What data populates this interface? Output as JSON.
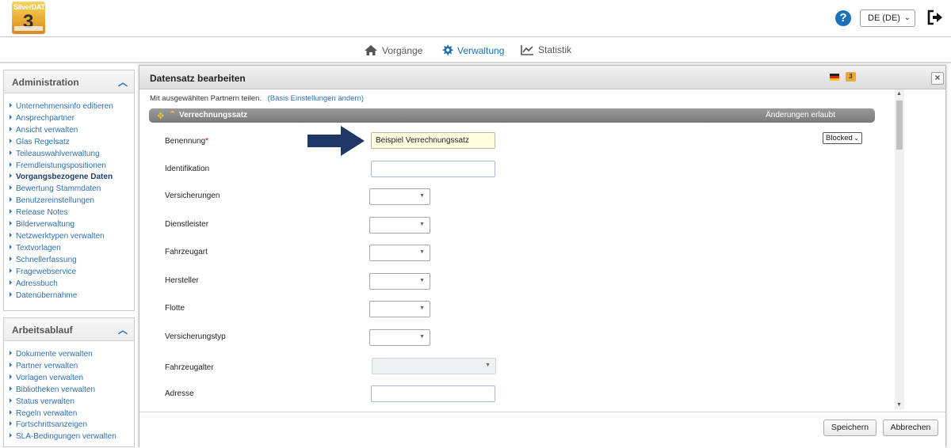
{
  "app": {
    "logo_text": "SilverDAT",
    "logo_number": "3",
    "language": "DE (DE)"
  },
  "nav": {
    "items": [
      {
        "label": "Vorgänge",
        "icon": "home-icon"
      },
      {
        "label": "Verwaltung",
        "icon": "gear-icon",
        "active": true
      },
      {
        "label": "Statistik",
        "icon": "chart-icon"
      }
    ]
  },
  "sidebar": {
    "administration": {
      "title": "Administration",
      "items": [
        "Unternehmensinfo editieren",
        "Ansprechpartner",
        "Ansicht verwalten",
        "Glas Regelsatz",
        "Teileauswahlverwaltung",
        "Fremdleistungspositionen",
        "Vorgangsbezogene Daten",
        "Bewertung Stammdaten",
        "Benutzereinstellungen",
        "Release Notes",
        "Bilderverwaltung",
        "Netzwerktypen verwalten",
        "Textvorlagen",
        "Schnellerfassung",
        "Fragewebservice",
        "Adressbuch",
        "Datenübernahme"
      ]
    },
    "arbeitsablauf": {
      "title": "Arbeitsablauf",
      "items": [
        "Dokumente verwalten",
        "Partner verwalten",
        "Vorlagen verwalten",
        "Bibliotheken verwalten",
        "Status verwalten",
        "Regeln verwalten",
        "Fortschrittsanzeigen",
        "SLA-Bedingungen verwalten"
      ]
    }
  },
  "dialog": {
    "title": "Datensatz bearbeiten",
    "share_text": "Mit ausgewählten Partnern teilen.",
    "share_link": "(Basis Einstellungen ändern)",
    "section_title": "Verrechnungssatz",
    "section_status": "Änderungen erlaubt",
    "blocked_value": "Blocked",
    "fields": {
      "benennung": {
        "label": "Benennung",
        "required_mark": "*",
        "value": "Beispiel Verrechnungssatz"
      },
      "identifikation": {
        "label": "Identifikation",
        "value": ""
      },
      "versicherungen": {
        "label": "Versicherungen"
      },
      "dienstleister": {
        "label": "Dienstleister"
      },
      "fahrzeugart": {
        "label": "Fahrzeugart"
      },
      "hersteller": {
        "label": "Hersteller"
      },
      "flotte": {
        "label": "Flotte"
      },
      "versicherungstyp": {
        "label": "Versicherungstyp"
      },
      "fahrzeugalter": {
        "label": "Fahrzeugalter"
      },
      "adresse": {
        "label": "Adresse",
        "value": ""
      }
    },
    "save_label": "Speichern",
    "cancel_label": "Abbrechen"
  },
  "colors": {
    "accent": "#1a6fb3",
    "annotation_arrow": "#1f3866",
    "section_bar": "#8a8a8a"
  }
}
